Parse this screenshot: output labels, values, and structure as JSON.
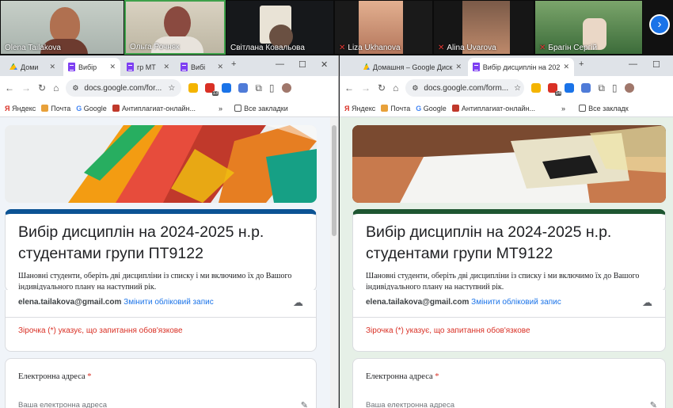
{
  "participants": [
    {
      "name": "Olena Tailakova",
      "muted": false
    },
    {
      "name": "Ольга Рочняк",
      "muted": false
    },
    {
      "name": "Світлана Ковальова",
      "muted": false
    },
    {
      "name": "Liza Ukhanova",
      "muted": true
    },
    {
      "name": "Alina Uvarova",
      "muted": true
    },
    {
      "name": "Брагін Сергій",
      "muted": true
    }
  ],
  "left": {
    "tabs": [
      "Доми",
      "Вибір",
      "гр МТ",
      "Вибі"
    ],
    "url": "docs.google.com/for...",
    "ext_badge": "13",
    "bookmarks": [
      "Яндекс",
      "Почта",
      "Google",
      "Антиплагиат-онлайн..."
    ],
    "all_bookmarks": "Все закладки",
    "form": {
      "title": "Вибір дисциплін на 2024-2025 н.р. студентами групи ПТ9122",
      "description": "Шановні студенти, оберіть дві дисципліни із списку і ми включимо їх до Вашого індивідуального плану на наступний рік.",
      "email": "elena.tailakova@gmail.com",
      "switch_account": "Змінити обліковий запис",
      "required_note": "Зірочка (*) указує, що запитання обов'язкове",
      "question": "Електронна адреса",
      "required_mark": "*",
      "placeholder": "Ваша електронна адреса",
      "accent": "#0b5394"
    }
  },
  "right": {
    "tabs": [
      "Домашня – Google Диск",
      "Вибір дисциплін на 202"
    ],
    "url": "docs.google.com/form...",
    "ext_badge": "14",
    "bookmarks": [
      "Яндекс",
      "Почта",
      "Google",
      "Антиплагиат-онлайн..."
    ],
    "all_bookmarks": "Все закладк",
    "form": {
      "title": "Вибір дисциплін на 2024-2025 н.р. студентами групи МТ9122",
      "description": "Шановні студенти, оберіть дві дисципліни із списку і ми включимо їх до Вашого індивідуального плану на наступний рік.",
      "email": "elena.tailakova@gmail.com",
      "switch_account": "Змінити обліковий запис",
      "required_note": "Зірочка (*) указує, що запитання обов'язкове",
      "question": "Електронна адреса",
      "required_mark": "*",
      "placeholder": "Ваша електронна адреса",
      "accent": "#1e5631"
    }
  },
  "colors": {
    "tabbar": "#dfe3e8",
    "left_bg": "#f0f4f9",
    "right_bg": "#e6f0e7",
    "link": "#1a73e8",
    "required": "#d93025"
  }
}
